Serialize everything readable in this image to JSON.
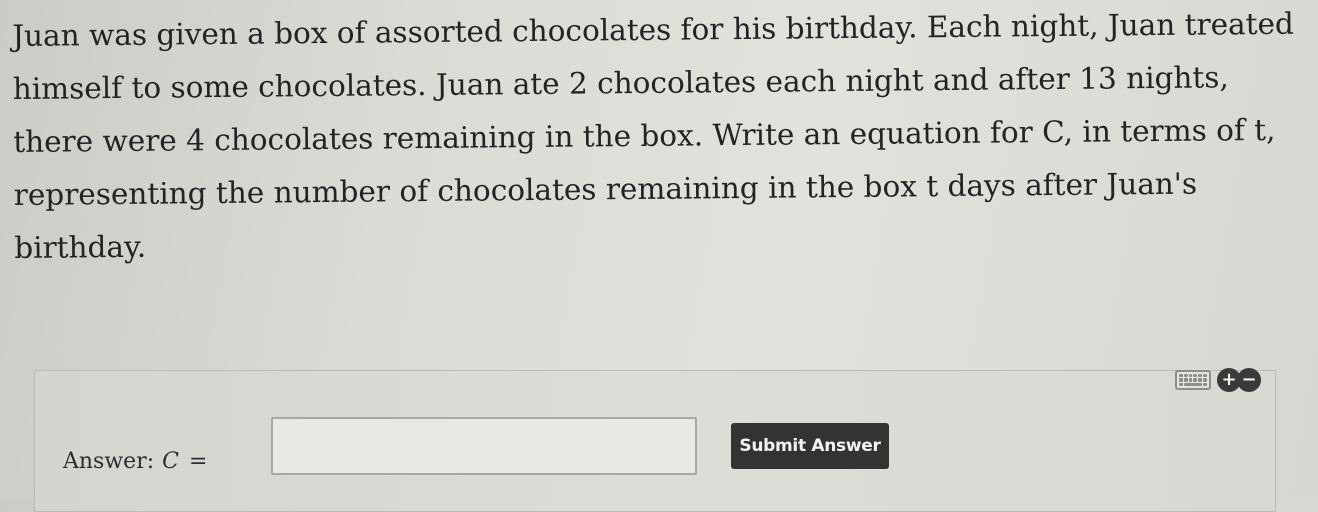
{
  "question": {
    "lines": [
      "Juan was given a box of assorted chocolates for his birthday. Each night, Juan treated",
      "himself to some chocolates. Juan ate 2 chocolates each night and after 13 nights,",
      "there were 4 chocolates remaining in the box. Write an equation for C, in terms of t,",
      "representing the number of chocolates remaining in the box t days after Juan's",
      "birthday."
    ]
  },
  "answer": {
    "label": "Answer:",
    "variable": "C",
    "equals": "=",
    "input_value": "",
    "submit_label": "Submit Answer"
  },
  "tools": {
    "keyboard_icon": "keyboard-icon",
    "plus_symbol": "+",
    "minus_symbol": "−"
  }
}
